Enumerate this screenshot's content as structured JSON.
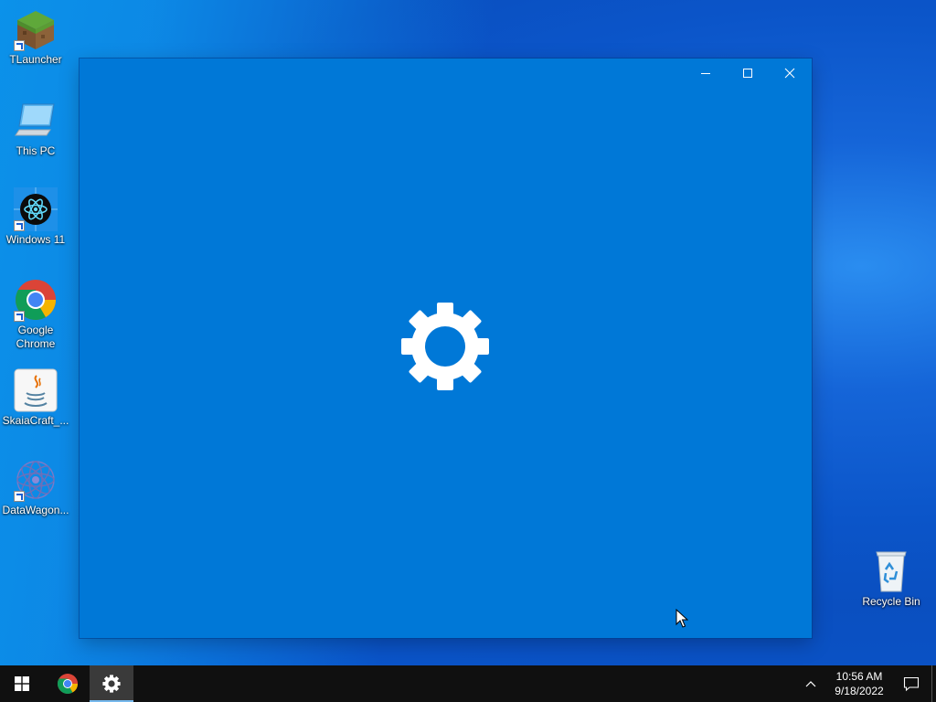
{
  "desktop": {
    "icons": [
      {
        "label": "TLauncher",
        "icon": "tlauncher-grass-block-icon"
      },
      {
        "label": "This PC",
        "icon": "computer-monitor-icon"
      },
      {
        "label": "Windows 11",
        "icon": "react-atom-icon"
      },
      {
        "label": "Google Chrome",
        "icon": "chrome-icon"
      },
      {
        "label": "SkaiaCraft_...",
        "icon": "java-icon"
      },
      {
        "label": "DataWagon...",
        "icon": "datawagon-icon"
      }
    ],
    "recycle_bin": {
      "label": "Recycle Bin",
      "icon": "recycle-bin-icon"
    }
  },
  "window": {
    "app": "Settings",
    "state": "loading-splash",
    "background_color": "#0078d7",
    "controls": [
      "minimize",
      "maximize",
      "close"
    ]
  },
  "taskbar": {
    "pinned": [
      "start",
      "chrome",
      "settings"
    ],
    "active": "settings",
    "clock": {
      "time": "10:56 AM",
      "date": "9/18/2022"
    }
  },
  "colors": {
    "accent": "#0078d7",
    "taskbar": "#101010",
    "active_indicator": "#76b9ed"
  }
}
